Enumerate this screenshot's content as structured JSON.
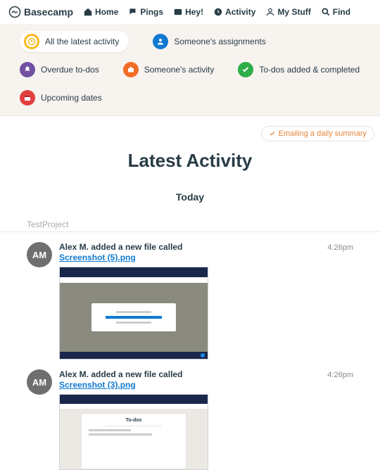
{
  "brand": "Basecamp",
  "nav": {
    "home": "Home",
    "pings": "Pings",
    "hey": "Hey!",
    "activity": "Activity",
    "mystuff": "My Stuff",
    "find": "Find"
  },
  "filters": {
    "latest": "All the latest activity",
    "assignments": "Someone's assignments",
    "overdue": "Overdue to-dos",
    "someone_activity": "Someone's activity",
    "todos": "To-dos added & completed",
    "upcoming": "Upcoming dates"
  },
  "summary_button": "Emailing a daily summary",
  "page_title": "Latest Activity",
  "day_header": "Today",
  "project": "TestProject",
  "entries": [
    {
      "avatar": "AM",
      "actor": "Alex M.",
      "action": "added a new file called",
      "filename": "Screenshot (5).png",
      "time": "4:26pm"
    },
    {
      "avatar": "AM",
      "actor": "Alex M.",
      "action": "added a new file called",
      "filename": "Screenshot (3).png",
      "time": "4:26pm"
    }
  ],
  "thumb2_card_title": "To-dos"
}
